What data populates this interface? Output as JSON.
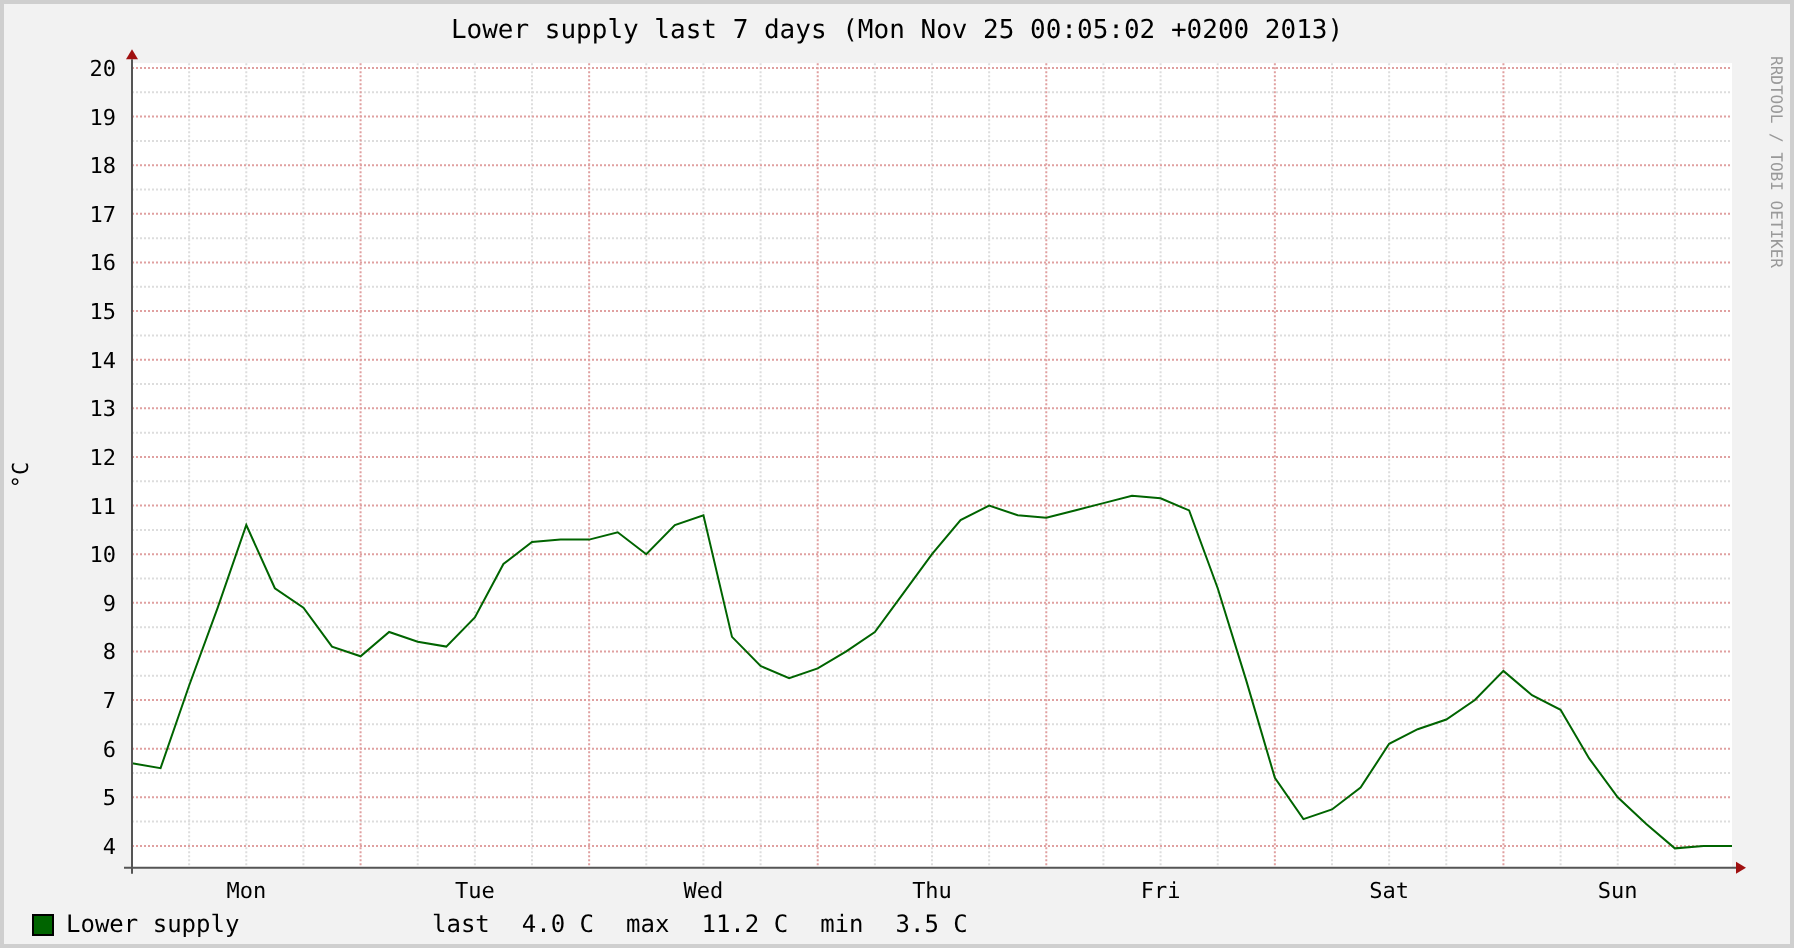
{
  "chart_data": {
    "type": "line",
    "grid": true,
    "title": "Lower supply last 7 days (Mon Nov 25 00:05:02 +0200 2013)",
    "ylabel": "°C",
    "ylim": [
      3.55,
      20.1
    ],
    "categories": [
      null,
      null,
      null,
      null,
      "Mon",
      null,
      null,
      null,
      null,
      null,
      null,
      null,
      "Tue",
      null,
      null,
      null,
      null,
      null,
      null,
      null,
      "Wed",
      null,
      null,
      null,
      null,
      null,
      null,
      null,
      "Thu",
      null,
      null,
      null,
      null,
      null,
      null,
      null,
      "Fri",
      null,
      null,
      null,
      null,
      null,
      null,
      null,
      "Sat",
      null,
      null,
      null,
      null,
      null,
      null,
      null,
      "Sun",
      null,
      null,
      null,
      null
    ],
    "yticks": [
      4,
      5,
      6,
      7,
      8,
      9,
      10,
      11,
      12,
      13,
      14,
      15,
      16,
      17,
      18,
      19,
      20
    ],
    "series": [
      {
        "name": "Lower supply",
        "color": "#006400",
        "values": [
          5.7,
          5.6,
          7.3,
          8.9,
          10.6,
          9.3,
          8.9,
          8.1,
          7.9,
          8.4,
          8.2,
          8.1,
          8.7,
          9.8,
          10.25,
          10.3,
          10.3,
          10.45,
          10.0,
          10.6,
          10.8,
          8.3,
          7.7,
          7.45,
          7.65,
          8.0,
          8.4,
          9.2,
          10.0,
          10.7,
          11.0,
          10.8,
          10.75,
          10.9,
          11.05,
          11.2,
          11.15,
          10.9,
          9.3,
          7.4,
          5.4,
          4.55,
          4.75,
          5.2,
          6.1,
          6.4,
          6.6,
          7.0,
          7.6,
          7.1,
          6.8,
          5.8,
          5.0,
          4.45,
          3.95,
          4.0,
          4.0
        ]
      }
    ]
  },
  "legend": {
    "stats": [
      "last",
      "4.0 C",
      "max",
      "11.2 C",
      "min",
      "3.5 C"
    ]
  },
  "credit": "RRDTOOL / TOBI OETIKER"
}
